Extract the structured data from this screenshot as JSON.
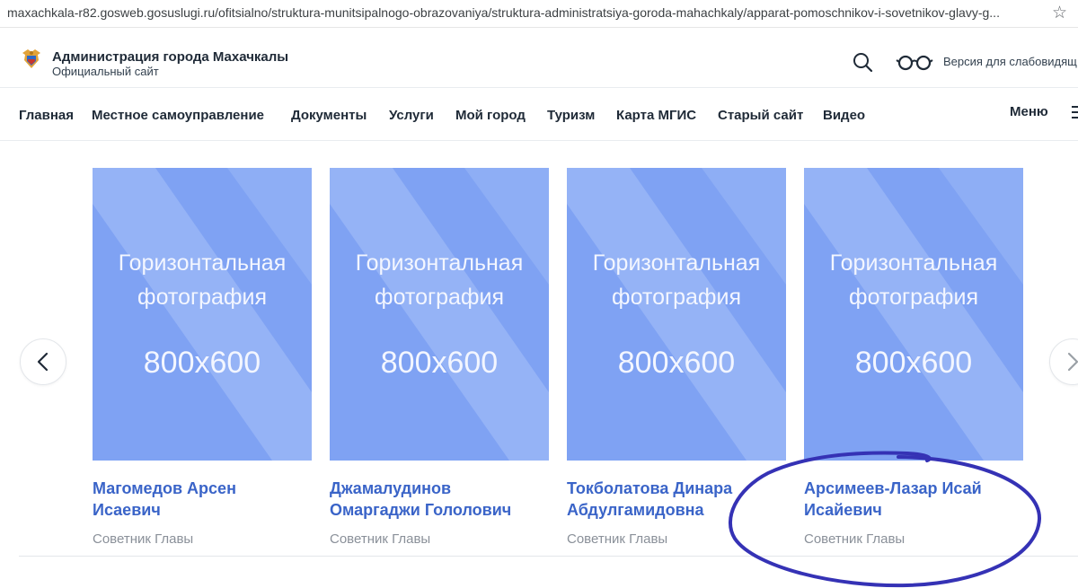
{
  "browser": {
    "url": "maxachkala-r82.gosweb.gosuslugi.ru/ofitsialno/struktura-munitsipalnogo-obrazovaniya/struktura-administratsiya-goroda-mahachkaly/apparat-pomoschnikov-i-sovetnikov-glavy-g...",
    "bookmark_icon": "star-icon"
  },
  "header": {
    "title": "Администрация города Махачкалы",
    "subtitle": "Официальный сайт",
    "accessibility_label": "Версия для слабовидящ",
    "icons": [
      "coat-of-arms-logo",
      "search-icon",
      "glasses-icon"
    ]
  },
  "nav": {
    "items": [
      "Главная",
      "Местное самоуправление",
      "Документы",
      "Услуги",
      "Мой город",
      "Туризм",
      "Карта МГИС",
      "Старый сайт",
      "Видео"
    ],
    "menu_label": "Меню"
  },
  "cards": [
    {
      "photo_line1": "Горизонтальная",
      "photo_line2": "фотография",
      "photo_dims": "800x600",
      "name_line1": "Магомедов Арсен",
      "name_line2": "Исаевич",
      "role": "Советник Главы"
    },
    {
      "photo_line1": "Горизонтальная",
      "photo_line2": "фотография",
      "photo_dims": "800x600",
      "name_line1": "Джамалудинов",
      "name_line2": "Омаргаджи Гололович",
      "role": "Советник Главы"
    },
    {
      "photo_line1": "Горизонтальная",
      "photo_line2": "фотография",
      "photo_dims": "800x600",
      "name_line1": "Токболатова Динара",
      "name_line2": "Абдулгамидовна",
      "role": "Советник Главы"
    },
    {
      "photo_line1": "Горизонтальная",
      "photo_line2": "фотография",
      "photo_dims": "800x600",
      "name_line1": "Арсимеев-Лазар Исай",
      "name_line2": "Исайевич",
      "role": "Советник Главы"
    }
  ],
  "colors": {
    "photo_placeholder": "#7fa2f3",
    "name_link": "#3a64c8",
    "annotation_ink": "#3532b5"
  }
}
